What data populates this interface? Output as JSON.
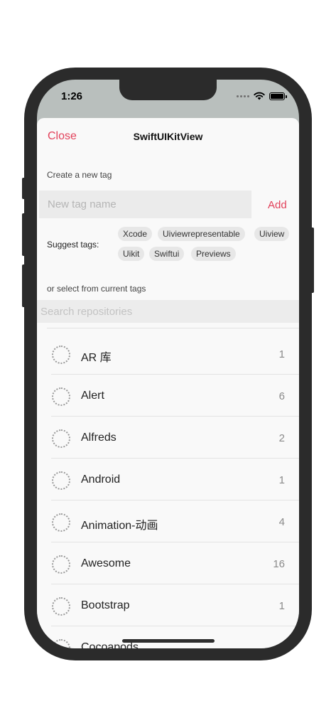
{
  "status_bar": {
    "time": "1:26"
  },
  "nav": {
    "close_label": "Close",
    "title": "SwiftUIKitView"
  },
  "create": {
    "label": "Create a new tag",
    "placeholder": "New tag name",
    "add_label": "Add"
  },
  "suggest": {
    "label": "Suggest tags:",
    "tags": [
      "Xcode",
      "Uiviewrepresentable",
      "Uiview",
      "Uikit",
      "Swiftui",
      "Previews"
    ]
  },
  "current": {
    "label": "or select from current tags",
    "search_placeholder": "Search repositories"
  },
  "tags_list": [
    {
      "name": "AR 库",
      "count": "1"
    },
    {
      "name": "Alert",
      "count": "6"
    },
    {
      "name": "Alfreds",
      "count": "2"
    },
    {
      "name": "Android",
      "count": "1"
    },
    {
      "name": "Animation-动画",
      "count": "4"
    },
    {
      "name": "Awesome",
      "count": "16"
    },
    {
      "name": "Bootstrap",
      "count": "1"
    },
    {
      "name": "Cocoapods",
      "count": ""
    }
  ],
  "colors": {
    "accent": "#e2415a"
  },
  "icons": {
    "wifi": "wifi-icon",
    "battery": "battery-icon",
    "signal": "signal-dots-icon",
    "checkbox": "unselected-circle-icon"
  }
}
